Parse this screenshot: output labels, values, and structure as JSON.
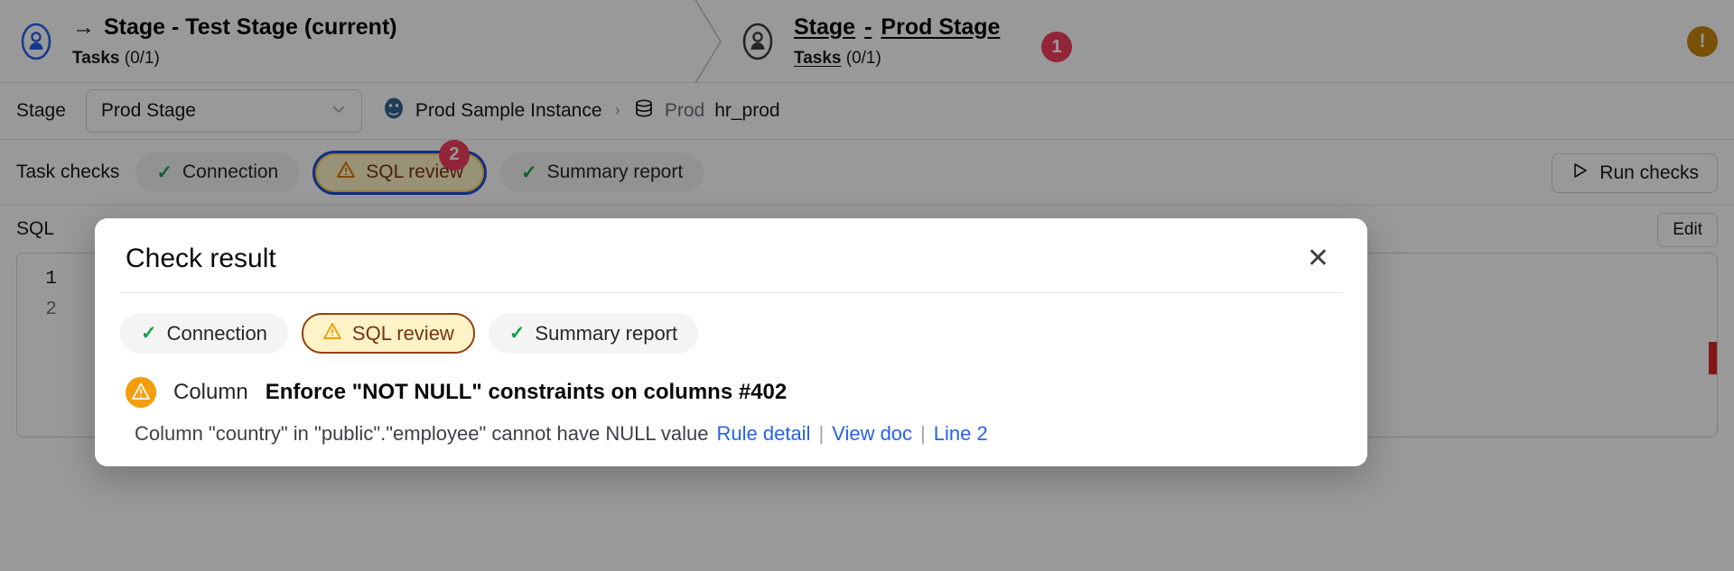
{
  "pipeline": {
    "stages": [
      {
        "arrow": "→",
        "title": "Stage - Test Stage (current)",
        "tasks_label": "Tasks",
        "tasks_count": "(0/1)",
        "icon": "user-circle-icon"
      },
      {
        "title_prefix": "Stage",
        "title_dash": "-",
        "title_name": "Prod Stage",
        "tasks_label": "Tasks",
        "tasks_count": "(0/1)",
        "icon": "user-circle-icon",
        "badge": "1"
      }
    ],
    "warning_glyph": "!"
  },
  "stage_row": {
    "label": "Stage",
    "select_value": "Prod Stage",
    "chevron": "⌄",
    "instance": "Prod Sample Instance",
    "separator": "›",
    "db_env": "Prod",
    "db_name": "hr_prod"
  },
  "checks_row": {
    "label": "Task checks",
    "chips": [
      {
        "label": "Connection",
        "icon": "check-icon",
        "state": "ok"
      },
      {
        "label": "SQL review",
        "icon": "warning-triangle-icon",
        "state": "warn",
        "badge": "2"
      },
      {
        "label": "Summary report",
        "icon": "check-icon",
        "state": "ok"
      }
    ],
    "run_button": "Run checks",
    "run_icon": "play-icon"
  },
  "sql_section": {
    "label": "SQL",
    "edit_button": "Edit",
    "line_numbers": [
      "1",
      "2"
    ]
  },
  "modal": {
    "title": "Check result",
    "close_icon": "close-icon",
    "chips": [
      {
        "label": "Connection",
        "icon": "check-icon",
        "state": "ok"
      },
      {
        "label": "SQL review",
        "icon": "warning-triangle-icon",
        "state": "warn"
      },
      {
        "label": "Summary report",
        "icon": "check-icon",
        "state": "ok"
      }
    ],
    "issue": {
      "severity_icon": "warning-circle-icon",
      "kind": "Column",
      "title": "Enforce \"NOT NULL\" constraints on columns #402",
      "detail": "Column \"country\" in \"public\".\"employee\" cannot have NULL value",
      "links": [
        "Rule detail",
        "View doc",
        "Line 2"
      ],
      "link_separator": "|"
    }
  },
  "colors": {
    "accent_blue": "#2563eb",
    "badge_red": "#f43f5e",
    "warn_amber": "#f59e0b",
    "ok_green": "#16a34a",
    "chip_warn_bg": "#fef3c7",
    "chip_warn_border": "#92400e",
    "selected_ring": "#1d4ed8"
  }
}
